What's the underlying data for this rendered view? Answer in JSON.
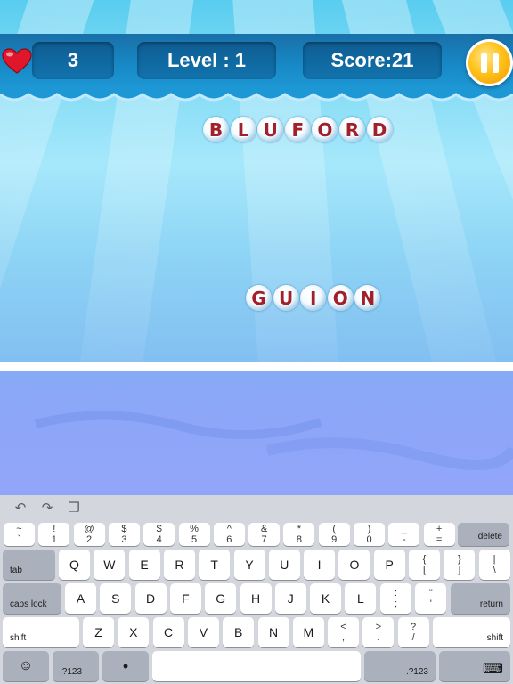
{
  "hud": {
    "lives": "3",
    "level": "Level : 1",
    "score": "Score:21"
  },
  "icons": {
    "lives": "heart-icon",
    "pause": "pause-icon"
  },
  "colors": {
    "letter": "#a1202a",
    "pause_button": "#ffc21a",
    "heart": "#e0162b"
  },
  "words": {
    "falling_word_1": [
      "B",
      "L",
      "U",
      "F",
      "O",
      "R",
      "D"
    ],
    "falling_word_2": [
      "G",
      "U",
      "I",
      "O",
      "N"
    ]
  },
  "keyboard": {
    "toolbar": [
      "undo-icon",
      "redo-icon",
      "paste-icon"
    ],
    "number_row": [
      {
        "top": "~",
        "bottom": "`"
      },
      {
        "top": "!",
        "bottom": "1"
      },
      {
        "top": "@",
        "bottom": "2"
      },
      {
        "top": "$",
        "bottom": "3"
      },
      {
        "top": "$",
        "bottom": "4"
      },
      {
        "top": "%",
        "bottom": "5"
      },
      {
        "top": "^",
        "bottom": "6"
      },
      {
        "top": "&",
        "bottom": "7"
      },
      {
        "top": "*",
        "bottom": "8"
      },
      {
        "top": "(",
        "bottom": "9"
      },
      {
        "top": ")",
        "bottom": "0"
      },
      {
        "top": "_",
        "bottom": "-"
      },
      {
        "top": "+",
        "bottom": "="
      }
    ],
    "delete": "delete",
    "tab": "tab",
    "row_q": [
      "Q",
      "W",
      "E",
      "R",
      "T",
      "Y",
      "U",
      "I",
      "O",
      "P"
    ],
    "row_q_extra": [
      {
        "top": "{",
        "bottom": "["
      },
      {
        "top": "}",
        "bottom": "]"
      },
      {
        "top": "|",
        "bottom": "\\"
      }
    ],
    "caps_lock": "caps lock",
    "row_a": [
      "A",
      "S",
      "D",
      "F",
      "G",
      "H",
      "J",
      "K",
      "L"
    ],
    "row_a_extra": [
      {
        "top": ":",
        "bottom": ";"
      },
      {
        "top": "\"",
        "bottom": "'"
      }
    ],
    "return": "return",
    "shift": "shift",
    "row_z": [
      "Z",
      "X",
      "C",
      "V",
      "B",
      "N",
      "M"
    ],
    "row_z_extra": [
      {
        "top": "<",
        "bottom": ","
      },
      {
        "top": ">",
        "bottom": "."
      },
      {
        "top": "?",
        "bottom": "/"
      }
    ],
    "numbers_key": ".?123",
    "bottom_icons": [
      "emoji-icon",
      "microphone-icon",
      "keyboard-dismiss-icon"
    ]
  }
}
